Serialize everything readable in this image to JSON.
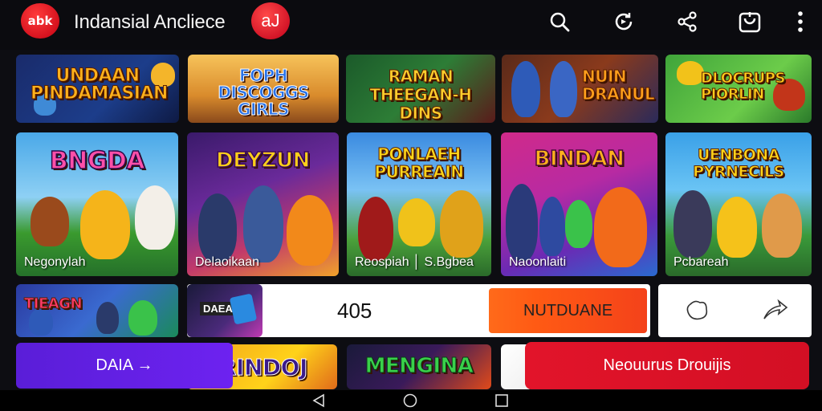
{
  "app": {
    "logo_text": "abk",
    "title": "Indansial Ancliece",
    "badge_text": "aJ"
  },
  "toolbar": {
    "icons": [
      "search-icon",
      "refresh-icon",
      "share-icon",
      "inbox-icon",
      "more-icon"
    ]
  },
  "row1": [
    {
      "title": "UNDAAN PINDAMASIAN"
    },
    {
      "title": "FOPH DISCOGGS GIRLS"
    },
    {
      "title": "RAMAN THEEGAN-H DINS"
    },
    {
      "title": "NUIN DRANUL"
    },
    {
      "title": "DLOCRUPS PIORLIN"
    }
  ],
  "row2": [
    {
      "title": "BNGDA",
      "caption": "Negonylah"
    },
    {
      "title": "DEYZUN",
      "caption": "Delaoikaan"
    },
    {
      "title": "PONLAEH PURREAIN",
      "caption": "Reospiah │ S.Bgbea"
    },
    {
      "title": "BINDAN",
      "caption": "Naoonlaiti"
    },
    {
      "title": "UENBONA PYRNECILS",
      "caption": "Pcbareah"
    }
  ],
  "row3": {
    "tile_title": "TIEAGN",
    "card_label": "DAEA",
    "counter": "405",
    "orange_button": "NUTDUANE"
  },
  "row4": {
    "tile2_title": "RINDOJ",
    "tile3_title": "MENGINA"
  },
  "bottom": {
    "purple_button": "DAIA →",
    "red_button": "Neouurus Drouijis"
  },
  "colors": {
    "accent_red": "#e2142a",
    "accent_purple": "#5a1ed8",
    "accent_orange": "#ff6a1a"
  }
}
